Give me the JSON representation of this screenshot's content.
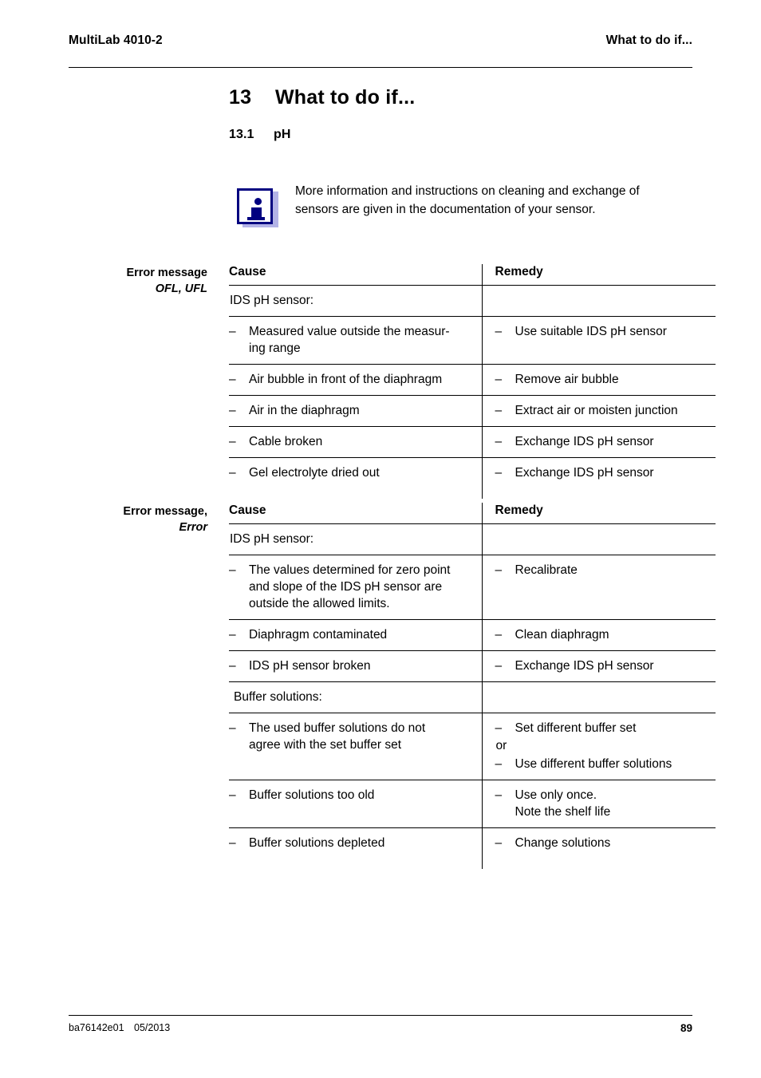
{
  "header": {
    "left": "MultiLab 4010-2",
    "right": "What to do if..."
  },
  "chapter": {
    "number": "13",
    "title": "What to do if..."
  },
  "section": {
    "number": "13.1",
    "title": "pH"
  },
  "note": {
    "icon": "info-icon",
    "line1": "More information and instructions on cleaning and exchange of",
    "line2": "sensors are given in the documentation of your sensor."
  },
  "tables": [
    {
      "margin_label_line1": "Error message",
      "margin_label_line2": "OFL, UFL",
      "headers": {
        "cause": "Cause",
        "remedy": "Remedy"
      },
      "rows": [
        {
          "type": "group",
          "cause": "IDS pH sensor:",
          "remedy": ""
        },
        {
          "type": "item",
          "cause_lines": [
            "Measured value outside the measur-",
            "ing range"
          ],
          "remedy_lines": [
            "Use suitable IDS pH sensor"
          ]
        },
        {
          "type": "item",
          "cause_lines": [
            "Air bubble in front of the diaphragm"
          ],
          "remedy_lines": [
            "Remove air bubble"
          ]
        },
        {
          "type": "item",
          "cause_lines": [
            "Air in the diaphragm"
          ],
          "remedy_lines": [
            "Extract air or moisten junction"
          ]
        },
        {
          "type": "item",
          "cause_lines": [
            "Cable broken"
          ],
          "remedy_lines": [
            "Exchange IDS pH sensor"
          ]
        },
        {
          "type": "item",
          "cause_lines": [
            "Gel electrolyte dried out"
          ],
          "remedy_lines": [
            "Exchange IDS pH sensor"
          ]
        }
      ]
    },
    {
      "margin_label_line1": "Error message,",
      "margin_label_line2": "Error",
      "headers": {
        "cause": "Cause",
        "remedy": "Remedy"
      },
      "rows": [
        {
          "type": "group",
          "cause": "IDS pH sensor:",
          "remedy": ""
        },
        {
          "type": "item",
          "cause_lines": [
            "The values determined for zero point",
            "and slope of the IDS pH sensor are",
            "outside the allowed limits."
          ],
          "remedy_lines": [
            "Recalibrate"
          ]
        },
        {
          "type": "item",
          "cause_lines": [
            "Diaphragm contaminated"
          ],
          "remedy_lines": [
            "Clean diaphragm"
          ]
        },
        {
          "type": "item",
          "cause_lines": [
            "IDS pH sensor broken"
          ],
          "remedy_lines": [
            "Exchange IDS pH sensor"
          ]
        },
        {
          "type": "group",
          "cause": "Buffer solutions:",
          "remedy": ""
        },
        {
          "type": "item",
          "cause_lines": [
            "The used buffer solutions do not",
            "agree with the set buffer set"
          ],
          "remedy_lines": [
            "Set different buffer set"
          ],
          "remedy_separator": "or",
          "remedy_lines2": [
            "Use different buffer solutions"
          ]
        },
        {
          "type": "item",
          "cause_lines": [
            "Buffer solutions too old"
          ],
          "remedy_lines": [
            "Use only once.",
            "Note the shelf life"
          ]
        },
        {
          "type": "item",
          "cause_lines": [
            "Buffer solutions depleted"
          ],
          "remedy_lines": [
            "Change solutions"
          ]
        }
      ]
    }
  ],
  "footer": {
    "doc_id": "ba76142e01",
    "date": "05/2013",
    "page_number": "89"
  },
  "colors": {
    "rule": "#000000",
    "note_icon_border": "#000080",
    "note_icon_shadow": "#b3b3e6"
  }
}
